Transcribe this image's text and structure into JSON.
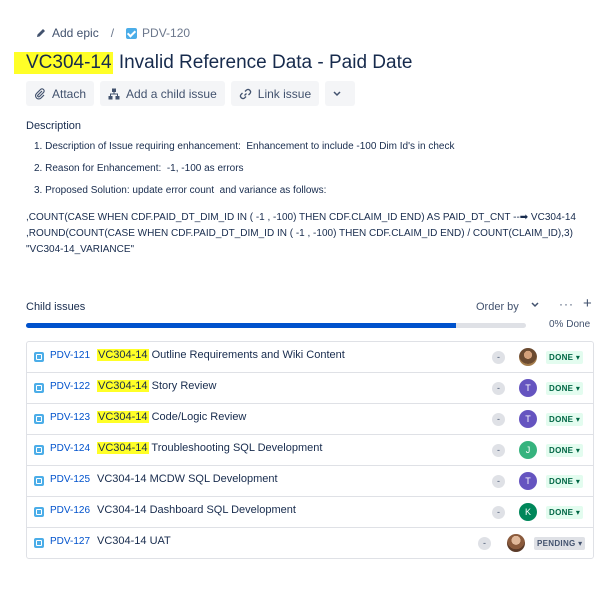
{
  "breadcrumb": {
    "add_epic": "Add epic",
    "separator": "/",
    "parent_key": "PDV-120"
  },
  "issue": {
    "title_key": "VC304-14",
    "title_rest": " Invalid Reference Data - Paid Date"
  },
  "actions": {
    "attach": "Attach",
    "add_child": "Add a child issue",
    "link": "Link issue"
  },
  "description": {
    "label": "Description",
    "items": [
      "1. Description of Issue requiring enhancement:  Enhancement to include -100 Dim Id's in check",
      "2. Reason for Enhancement:  -1, -100 as errors",
      "3. Proposed Solution: update error count  and variance as follows:"
    ],
    "sql": [
      ",COUNT(CASE WHEN CDF.PAID_DT_DIM_ID IN ( -1 , -100) THEN CDF.CLAIM_ID END) AS PAID_DT_CNT --➡ VC304-14",
      ",ROUND(COUNT(CASE WHEN CDF.PAID_DT_DIM_ID IN ( -1 , -100) THEN CDF.CLAIM_ID END) / COUNT(CLAIM_ID),3)",
      "\"VC304-14_VARIANCE\""
    ]
  },
  "child_issues": {
    "label": "Child issues",
    "order_by": "Order by",
    "more": "···",
    "add": "+",
    "progress_fraction": 0.86,
    "progress_text": "0% Done",
    "rows": [
      {
        "key": "PDV-121",
        "summary_hl": "VC304-14",
        "summary_rest": " Outline Requirements and Wiki Content",
        "priority": "-",
        "assignee": "",
        "status": "DONE"
      },
      {
        "key": "PDV-122",
        "summary_hl": "VC304-14",
        "summary_rest": " Story Review",
        "priority": "-",
        "assignee": "T",
        "status": "DONE"
      },
      {
        "key": "PDV-123",
        "summary_hl": "VC304-14",
        "summary_rest": " Code/Logic Review",
        "priority": "-",
        "assignee": "T",
        "status": "DONE"
      },
      {
        "key": "PDV-124",
        "summary_hl": "VC304-14",
        "summary_rest": " Troubleshooting SQL Development",
        "priority": "-",
        "assignee": "J",
        "status": "DONE"
      },
      {
        "key": "PDV-125",
        "summary_hl": "",
        "summary_rest": "VC304-14 MCDW SQL Development",
        "priority": "-",
        "assignee": "T",
        "status": "DONE"
      },
      {
        "key": "PDV-126",
        "summary_hl": "",
        "summary_rest": "VC304-14 Dashboard SQL Development",
        "priority": "-",
        "assignee": "K",
        "status": "DONE"
      },
      {
        "key": "PDV-127",
        "summary_hl": "",
        "summary_rest": "VC304-14 UAT",
        "priority": "-",
        "assignee": "",
        "status": "PENDING"
      }
    ]
  },
  "colors": {
    "highlight": "#ffff27",
    "link": "#0052cc",
    "avatar_t": "#6554c0",
    "avatar_j": "#36b37e",
    "avatar_k": "#00875a"
  }
}
